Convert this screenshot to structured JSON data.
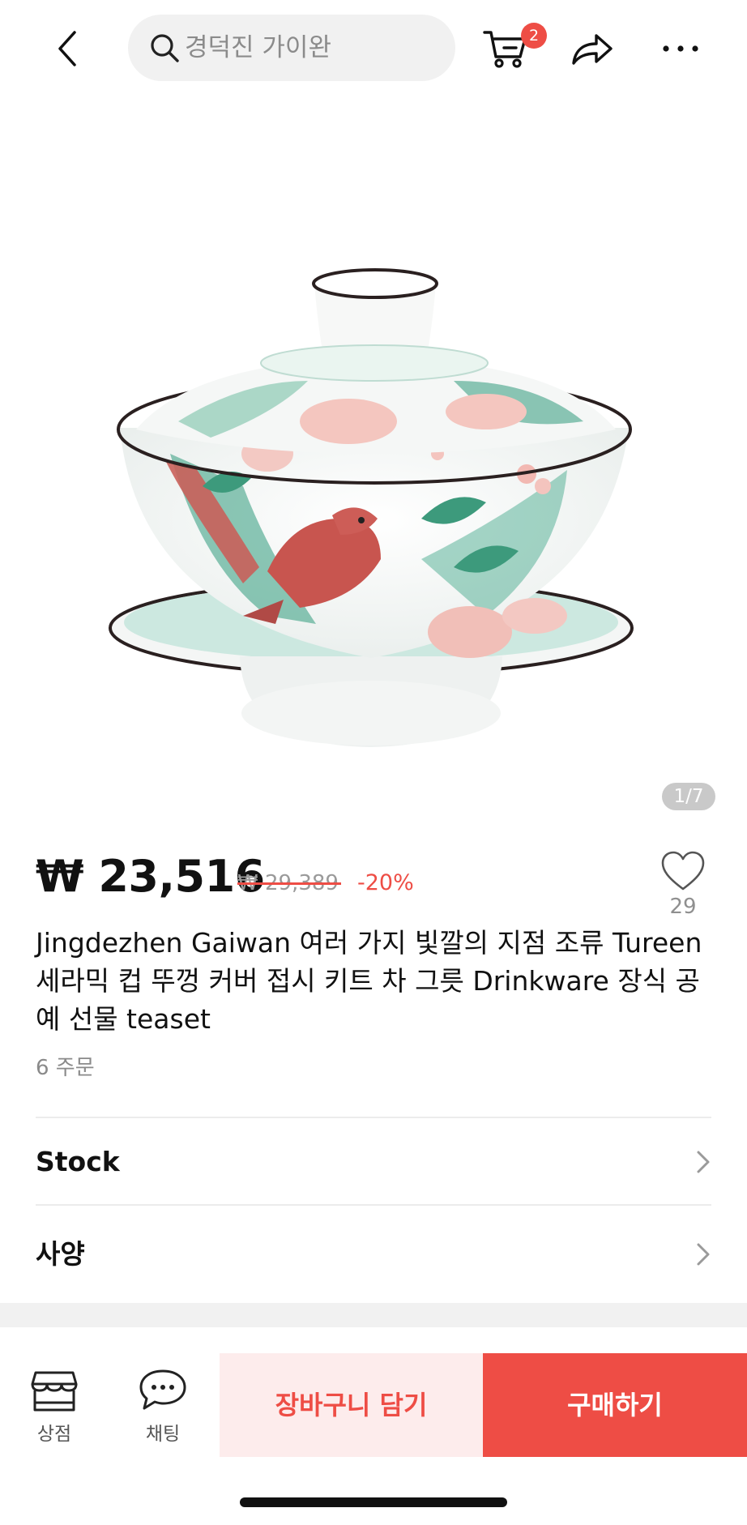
{
  "header": {
    "search_placeholder": "경덕진 가이완",
    "cart_badge": "2"
  },
  "gallery": {
    "counter": "1/7"
  },
  "product": {
    "price": "₩ 23,516",
    "original_price": "₩ 29,389",
    "discount": "-20%",
    "wishlist_count": "29",
    "title": "Jingdezhen Gaiwan 여러 가지 빛깔의 지점 조류 Tureen 세라믹 컵 뚜껑 커버 접시 키트 차 그릇 Drinkware 장식 공예 선물 teaset",
    "orders": "6 주문"
  },
  "rows": {
    "stock_label": "Stock",
    "spec_label": "사양"
  },
  "bottom_bar": {
    "store_label": "상점",
    "chat_label": "채팅",
    "add_to_cart_label": "장바구니 담기",
    "buy_label": "구매하기"
  },
  "colors": {
    "accent": "#ee4d45",
    "accent_light": "#fdecec",
    "badge_bg": "#ee4d45"
  },
  "icons": [
    "back-arrow-icon",
    "search-icon",
    "cart-icon",
    "share-icon",
    "more-dots-icon",
    "heart-icon",
    "chevron-right-icon",
    "store-icon",
    "chat-icon"
  ]
}
